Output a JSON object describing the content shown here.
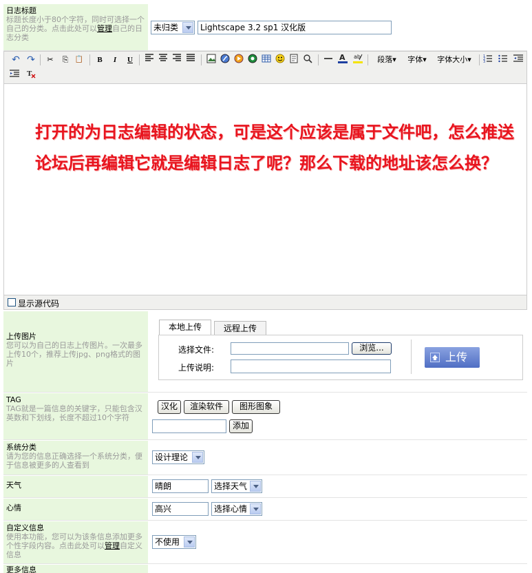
{
  "title_row": {
    "label": "日志标题",
    "desc_prefix": "标题长度小于80个字符，同时可选择一个自己的分类。点击此处可以",
    "desc_link": "管理",
    "desc_suffix": "自己的日志分类",
    "category": "未归类",
    "title_value": "Lightscape 3.2 sp1 汉化版"
  },
  "toolbar": {
    "undo": "↶",
    "redo": "↷",
    "cut": "✂",
    "copy": "⎘",
    "paste": "📋",
    "bold": "B",
    "italic": "I",
    "underline": "U",
    "paragraph": "段落▾",
    "font": "字体▾",
    "font_size": "字体大小▾"
  },
  "editor": {
    "content": "打开的为日志编辑的状态，可是这个应该是属于文件吧，怎么推送论坛后再编辑它就是编辑日志了呢？那么下载的地址该怎么换？"
  },
  "source": {
    "label": "显示源代码"
  },
  "upload": {
    "label": "上传图片",
    "desc": "您可以为自己的日志上传图片。一次最多上传10个，推荐上传jpg、png格式的图片",
    "tab_local": "本地上传",
    "tab_remote": "远程上传",
    "file_label": "选择文件:",
    "browse": "浏览...",
    "note_label": "上传说明:",
    "upload_button": "上传"
  },
  "tag": {
    "label": "TAG",
    "desc": "TAG就是一篇信息的关键字，只能包含汉英数和下划线，长度不超过10个字符",
    "tags": [
      "汉化",
      "渲染软件",
      "图形图象"
    ],
    "add": "添加"
  },
  "system_category": {
    "label": "系统分类",
    "desc": "请为您的信息正确选择一个系统分类，便于信息被更多的人查看到",
    "value": "设计理论"
  },
  "weather": {
    "label": "天气",
    "value": "晴朗",
    "select": "选择天气"
  },
  "mood": {
    "label": "心情",
    "value": "高兴",
    "select": "选择心情"
  },
  "custom": {
    "label": "自定义信息",
    "desc_prefix": "使用本功能，您可以为该条信息添加更多个性字段内容。点击此处可以",
    "desc_link": "管理",
    "desc_suffix": "自定义信息",
    "value": "不使用"
  },
  "more": {
    "label": "更多信息"
  },
  "colors": {
    "label_bg": "#e8f7de",
    "editor_text": "#e8141e",
    "toolbar_bg": "#f0f0ee"
  }
}
